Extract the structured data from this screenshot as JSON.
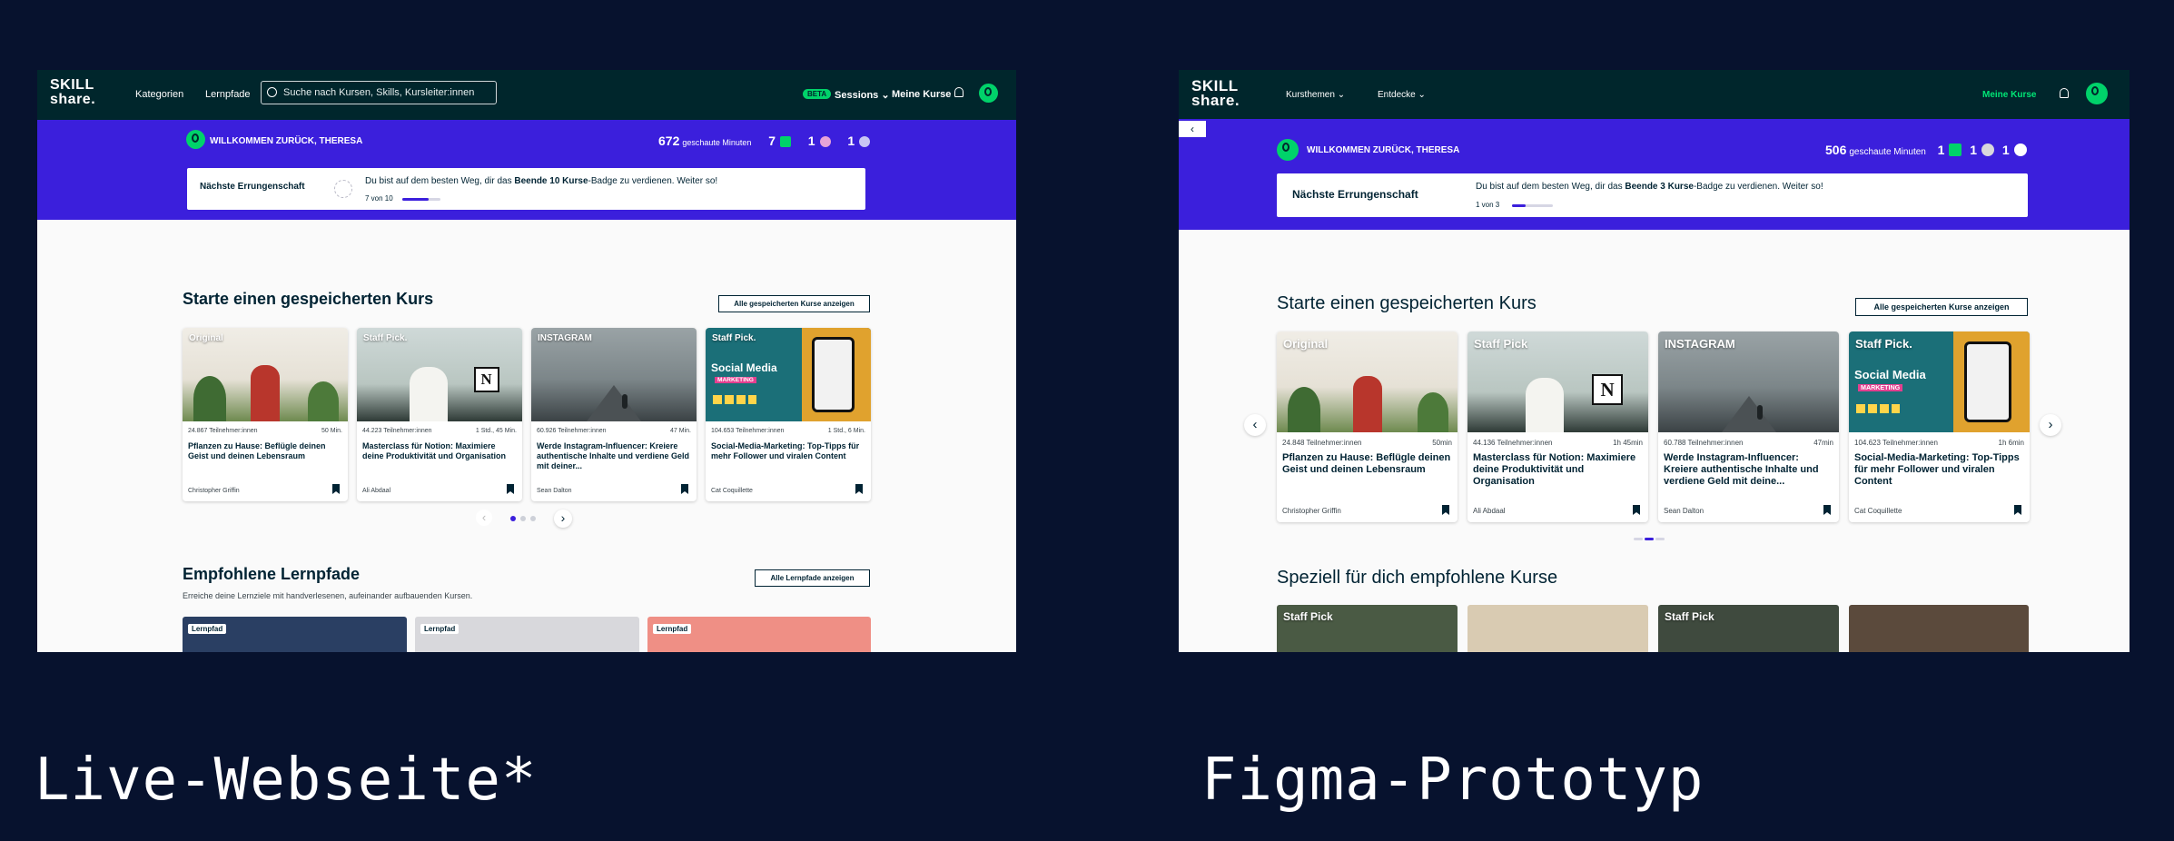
{
  "colors": {
    "page_bg": "#07122e",
    "nav_bg": "#00262c",
    "banner": "#3b1fdc",
    "accent_green": "#00d26a",
    "text_dark": "#002333"
  },
  "captions": {
    "live": "Live-Webseite*",
    "figma": "Figma-Prototyp"
  },
  "live": {
    "logo_line1": "SKILL",
    "logo_line2": "share.",
    "nav": {
      "categories": "Kategorien",
      "paths": "Lernpfade",
      "search_placeholder": "Suche nach Kursen, Skills, Kursleiter:innen",
      "beta": "BETA",
      "sessions": "Sessions",
      "my_courses": "Meine Kurse"
    },
    "welcome": "WILLKOMMEN ZURÜCK, THERESA",
    "stats": {
      "minutes": "672",
      "minutes_label": "geschaute Minuten",
      "s1": "7",
      "s2": "1",
      "s3": "1"
    },
    "achievement": {
      "title": "Nächste Errungenschaft",
      "text_pre": "Du bist auf dem besten Weg, dir das ",
      "text_bold": "Beende 10 Kurse",
      "text_post": "-Badge zu verdienen. Weiter so!",
      "progress": "7 von 10",
      "progress_value": 0.7
    },
    "saved": {
      "title": "Starte einen gespeicherten Kurs",
      "button": "Alle gespeicherten Kurse anzeigen",
      "cards": [
        {
          "label": "Original",
          "students": "24.867 Teilnehmer:innen",
          "duration": "50 Min.",
          "title": "Pflanzen zu Hause: Beflügle deinen Geist und deinen Lebensraum",
          "author": "Christopher Griffin"
        },
        {
          "label": "Staff Pick.",
          "students": "44.223 Teilnehmer:innen",
          "duration": "1 Std., 45 Min.",
          "title": "Masterclass für Notion: Maximiere deine Produktivität und Organisation",
          "author": "Ali Abdaal"
        },
        {
          "label": "INSTAGRAM",
          "students": "60.926 Teilnehmer:innen",
          "duration": "47 Min.",
          "title": "Werde Instagram-Influencer: Kreiere authentische Inhalte und verdiene Geld mit deiner...",
          "author": "Sean Dalton"
        },
        {
          "label": "Staff Pick.",
          "students": "104.653 Teilnehmer:innen",
          "duration": "1 Std., 6 Min.",
          "title": "Social-Media-Marketing: Top-Tipps für mehr Follower und viralen Content",
          "author": "Cat Coquillette"
        }
      ]
    },
    "paths": {
      "title": "Empfohlene Lernpfade",
      "button": "Alle Lernpfade anzeigen",
      "subtitle": "Erreiche deine Lernziele mit handverlesenen, aufeinander aufbauenden Kursen.",
      "tag": "Lernpfad"
    }
  },
  "figma": {
    "logo_line1": "SKILL",
    "logo_line2": "share.",
    "nav": {
      "topics": "Kursthemen",
      "discover": "Entdecke",
      "my_courses": "Meine Kurse"
    },
    "back": "‹",
    "welcome": "WILLKOMMEN ZURÜCK, THERESA",
    "stats": {
      "minutes": "506",
      "minutes_label": "geschaute Minuten",
      "s1": "1",
      "s2": "1",
      "s3": "1"
    },
    "achievement": {
      "title": "Nächste Errungenschaft",
      "text_pre": "Du bist auf dem besten Weg, dir das ",
      "text_bold": "Beende 3 Kurse",
      "text_post": "-Badge zu verdienen. Weiter so!",
      "progress": "1 von 3",
      "progress_value": 0.33
    },
    "saved": {
      "title": "Starte einen gespeicherten Kurs",
      "button": "Alle gespeicherten Kurse anzeigen",
      "cards": [
        {
          "label": "Original",
          "students": "24.848 Teilnehmer:innen",
          "duration": "50min",
          "title": "Pflanzen zu Hause: Beflügle deinen Geist und deinen Lebensraum",
          "author": "Christopher Griffin"
        },
        {
          "label": "Staff Pick",
          "students": "44.136 Teilnehmer:innen",
          "duration": "1h 45min",
          "title": "Masterclass für Notion: Maximiere deine Produktivität und Organisation",
          "author": "Ali Abdaal"
        },
        {
          "label": "INSTAGRAM",
          "students": "60.788 Teilnehmer:innen",
          "duration": "47min",
          "title": "Werde Instagram-Influencer: Kreiere authentische Inhalte und verdiene Geld mit deine...",
          "author": "Sean Dalton"
        },
        {
          "label": "Staff Pick.",
          "students": "104.623 Teilnehmer:innen",
          "duration": "1h 6min",
          "title": "Social-Media-Marketing: Top-Tipps für mehr Follower und viralen Content",
          "author": "Cat Coquillette"
        }
      ]
    },
    "recommended": {
      "title": "Speziell für dich empfohlene Kurse",
      "labels": [
        "Staff Pick",
        "Staff Pick"
      ]
    }
  },
  "thumb_texts": {
    "social_media": "Social Media",
    "marketing": "MARKETING",
    "notion": "N"
  }
}
